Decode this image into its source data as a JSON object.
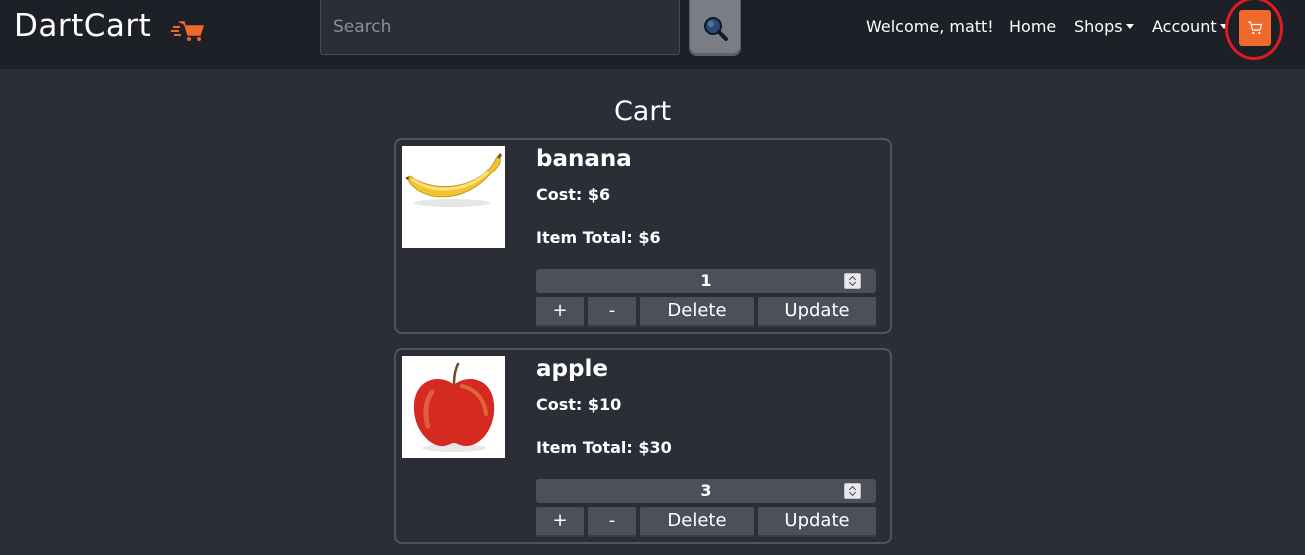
{
  "app": {
    "brand": "DartCart"
  },
  "search": {
    "placeholder": "Search",
    "value": ""
  },
  "nav": {
    "welcome": "Welcome, matt!",
    "home": "Home",
    "shops": "Shops",
    "account": "Account"
  },
  "colors": {
    "accent": "#f0692a",
    "highlight": "#e01b22"
  },
  "cart": {
    "title": "Cart",
    "items": [
      {
        "name": "banana",
        "cost": "Cost: $6",
        "total": "Item Total: $6",
        "quantity": "1",
        "image": "banana-image"
      },
      {
        "name": "apple",
        "cost": "Cost: $10",
        "total": "Item Total: $30",
        "quantity": "3",
        "image": "apple-image"
      }
    ],
    "buttons": {
      "plus": "+",
      "minus": "-",
      "delete": "Delete",
      "update": "Update"
    }
  }
}
